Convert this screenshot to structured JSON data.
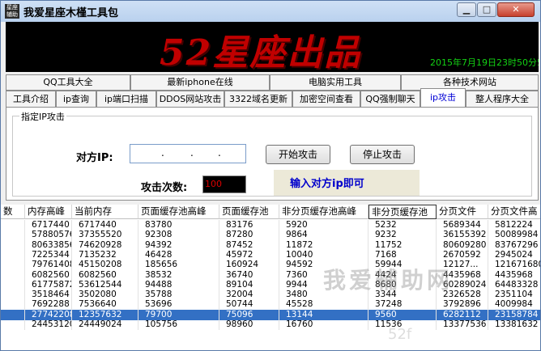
{
  "window": {
    "title": "我爱星座木槿工具包",
    "icon_text": "星座\n辅助"
  },
  "banner": {
    "text": "52星座出品",
    "timestamp": "2015年7月19日23时50分5"
  },
  "tabs_row1": [
    "QQ工具大全",
    "最新iphone在线",
    "电脑实用工具",
    "各种技术网站"
  ],
  "tabs_row2": [
    "工具介绍",
    "ip查询",
    "ip端口扫描",
    "DDOS网站攻击",
    "3322域名更新",
    "加密空间查看",
    "QQ强制聊天",
    "ip攻击",
    "整人程序大全"
  ],
  "active_tab": "ip攻击",
  "attack_panel": {
    "group_title": "指定IP攻击",
    "ip_label": "对方IP:",
    "ip_dots": [
      ".",
      ".",
      "."
    ],
    "start_button": "开始攻击",
    "stop_button": "停止攻击",
    "count_label": "攻击次数:",
    "count_value": "100",
    "hint": "输入对方ip即可"
  },
  "grid": {
    "headers": [
      "数",
      "内存高峰",
      "当前内存",
      "页面缓存池高峰",
      "页面缓存池",
      "非分页缓存池高峰",
      "非分页缓存池",
      "分页文件",
      "分页文件高"
    ],
    "selected_header": 6,
    "rows": [
      [
        "",
        "6717440",
        "6717440",
        "83780",
        "83176",
        "5920",
        "5232",
        "5689344",
        "5812224"
      ],
      [
        "",
        "57880576",
        "37355520",
        "92308",
        "87280",
        "9864",
        "9232",
        "36155392",
        "50089984"
      ],
      [
        "",
        "80633856",
        "74620928",
        "94392",
        "87452",
        "11872",
        "11752",
        "80609280",
        "83767296"
      ],
      [
        "",
        "7225344",
        "7135232",
        "46428",
        "45972",
        "10040",
        "7168",
        "2670592",
        "2945024"
      ],
      [
        "",
        "79761408",
        "45150208",
        "185656",
        "160924",
        "94592",
        "59944",
        "12127...",
        "121671680"
      ],
      [
        "",
        "6082560",
        "6082560",
        "38532",
        "36740",
        "7360",
        "4424",
        "4435968",
        "4435968"
      ],
      [
        "",
        "61775872",
        "53612544",
        "94488",
        "89104",
        "9944",
        "8680",
        "60289024",
        "64483328"
      ],
      [
        "",
        "3518464",
        "3502080",
        "35788",
        "32004",
        "3480",
        "3344",
        "2326528",
        "2351104"
      ],
      [
        "",
        "7692288",
        "7536640",
        "53696",
        "50744",
        "45528",
        "37248",
        "3792896",
        "4009984"
      ],
      [
        "",
        "27742208",
        "12357632",
        "79700",
        "75096",
        "13144",
        "9560",
        "6282112",
        "23158784"
      ],
      [
        "",
        "24453120",
        "24449024",
        "105756",
        "98960",
        "16760",
        "11536",
        "13377536",
        "13381632"
      ]
    ],
    "selected_row": 9
  },
  "watermark": {
    "text": "我爱辅助网",
    "sub": "52f"
  }
}
